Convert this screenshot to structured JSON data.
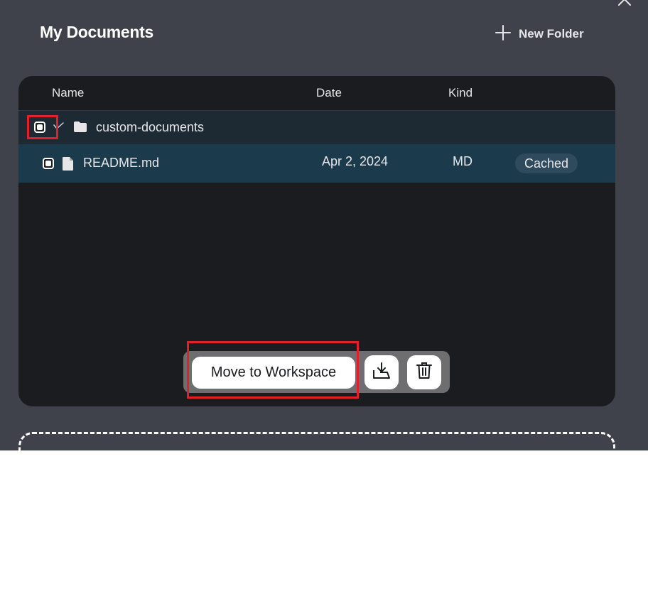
{
  "header": {
    "title": "My Documents",
    "new_folder_label": "New Folder"
  },
  "table": {
    "columns": [
      "Name",
      "Date",
      "Kind"
    ],
    "folder": {
      "name": "custom-documents",
      "expanded": true
    },
    "files": [
      {
        "name": "README.md",
        "date": "Apr 2, 2024",
        "kind": "MD",
        "status": "Cached"
      }
    ]
  },
  "actions": {
    "move_label": "Move to Workspace"
  },
  "colors": {
    "modal_bg": "#3f424a",
    "panel_bg": "#1b1c1f",
    "folder_row_bg": "#1d2a34",
    "file_row_bg": "#1b3a4c",
    "highlight": "#e0202a"
  },
  "icons": [
    "close-icon",
    "plus-icon",
    "chevron-down-icon",
    "folder-icon",
    "file-icon",
    "download-icon",
    "trash-icon"
  ]
}
